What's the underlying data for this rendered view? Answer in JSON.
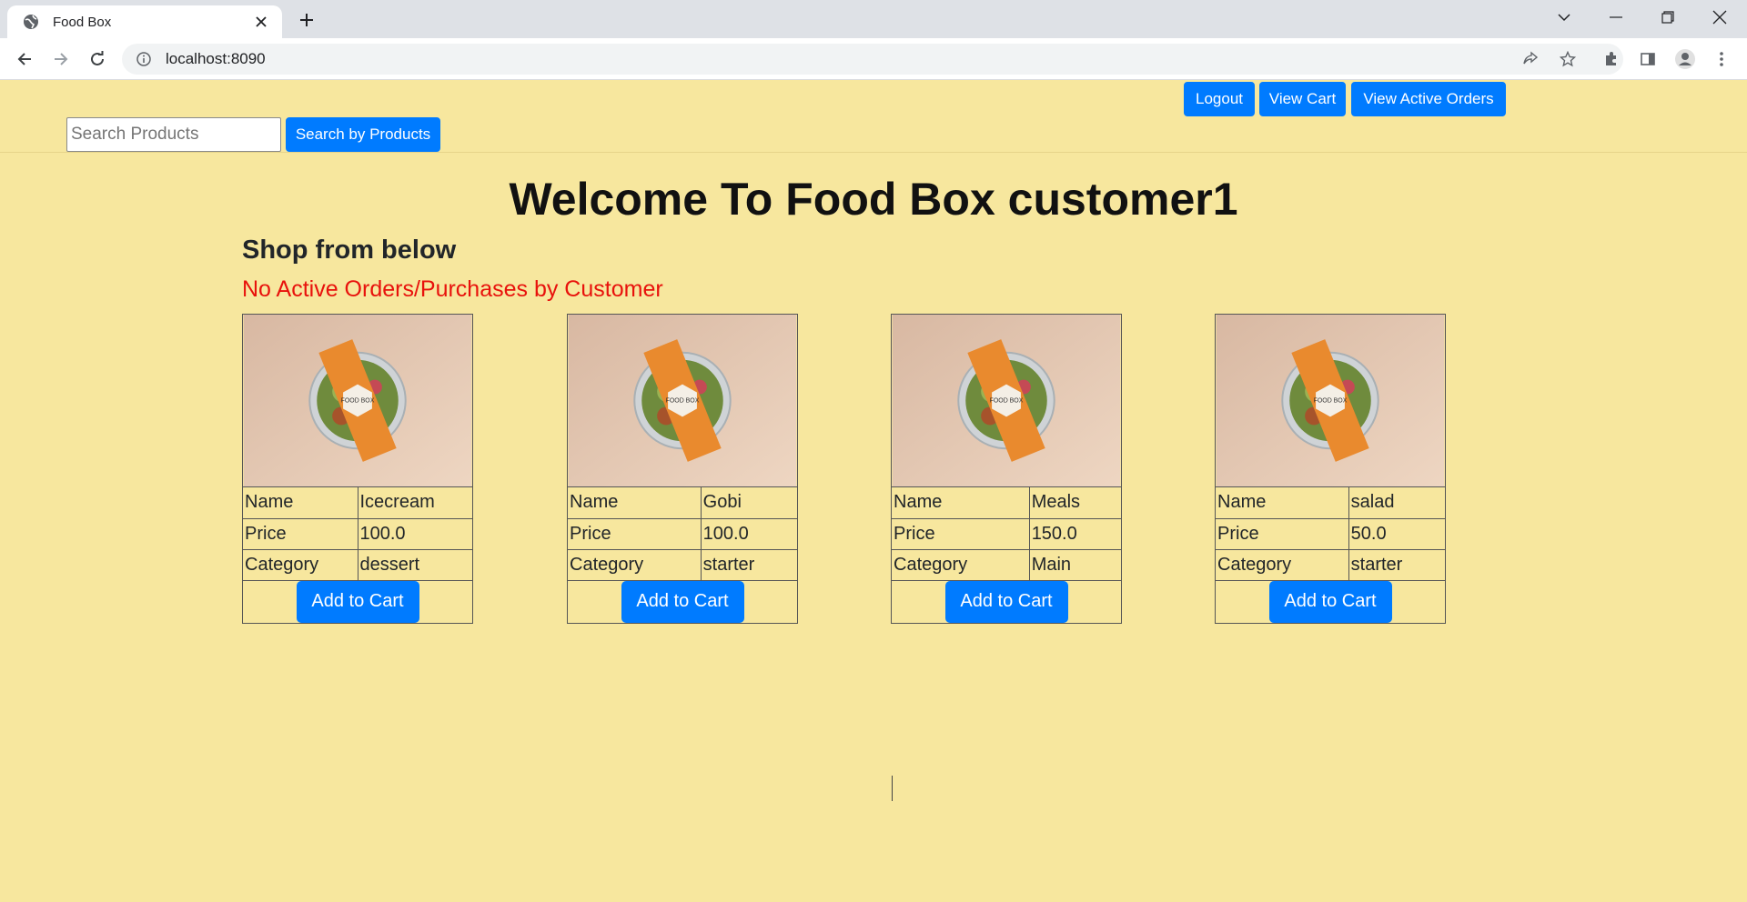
{
  "browser": {
    "tab_title": "Food Box",
    "url": "localhost:8090",
    "icons": {
      "favicon": "globe-icon",
      "tab_close": "close-icon",
      "new_tab": "plus-icon",
      "back": "back-arrow-icon",
      "forward": "forward-arrow-icon",
      "reload": "reload-icon",
      "site_info": "info-icon",
      "share": "share-icon",
      "bookmark": "star-icon",
      "extensions": "puzzle-icon",
      "side_panel": "side-panel-icon",
      "profile": "profile-icon",
      "menu": "kebab-menu-icon",
      "tab_search": "chevron-down-icon",
      "minimize": "minimize-icon",
      "restore": "restore-icon",
      "close_window": "close-icon"
    }
  },
  "nav": {
    "logout_label": "Logout",
    "view_cart_label": "View Cart",
    "view_active_orders_label": "View Active Orders",
    "search_placeholder": "Search Products",
    "search_button_label": "Search by Products"
  },
  "page": {
    "welcome": "Welcome To Food Box customer1",
    "shop_heading": "Shop from below",
    "no_orders": "No Active Orders/Purchases by Customer",
    "colors": {
      "background": "#f7e79e",
      "primary_button": "#007bff",
      "alert_text": "#e8120c"
    }
  },
  "products": [
    {
      "name_label": "Name",
      "name": "Icecream",
      "price_label": "Price",
      "price": "100.0",
      "category_label": "Category",
      "category": "dessert",
      "button": "Add to Cart"
    },
    {
      "name_label": "Name",
      "name": "Gobi",
      "price_label": "Price",
      "price": "100.0",
      "category_label": "Category",
      "category": "starter",
      "button": "Add to Cart"
    },
    {
      "name_label": "Name",
      "name": "Meals",
      "price_label": "Price",
      "price": "150.0",
      "category_label": "Category",
      "category": "Main",
      "button": "Add to Cart"
    },
    {
      "name_label": "Name",
      "name": "salad",
      "price_label": "Price",
      "price": "50.0",
      "category_label": "Category",
      "category": "starter",
      "button": "Add to Cart"
    }
  ],
  "product_image_logo_text": "FOOD BOX"
}
